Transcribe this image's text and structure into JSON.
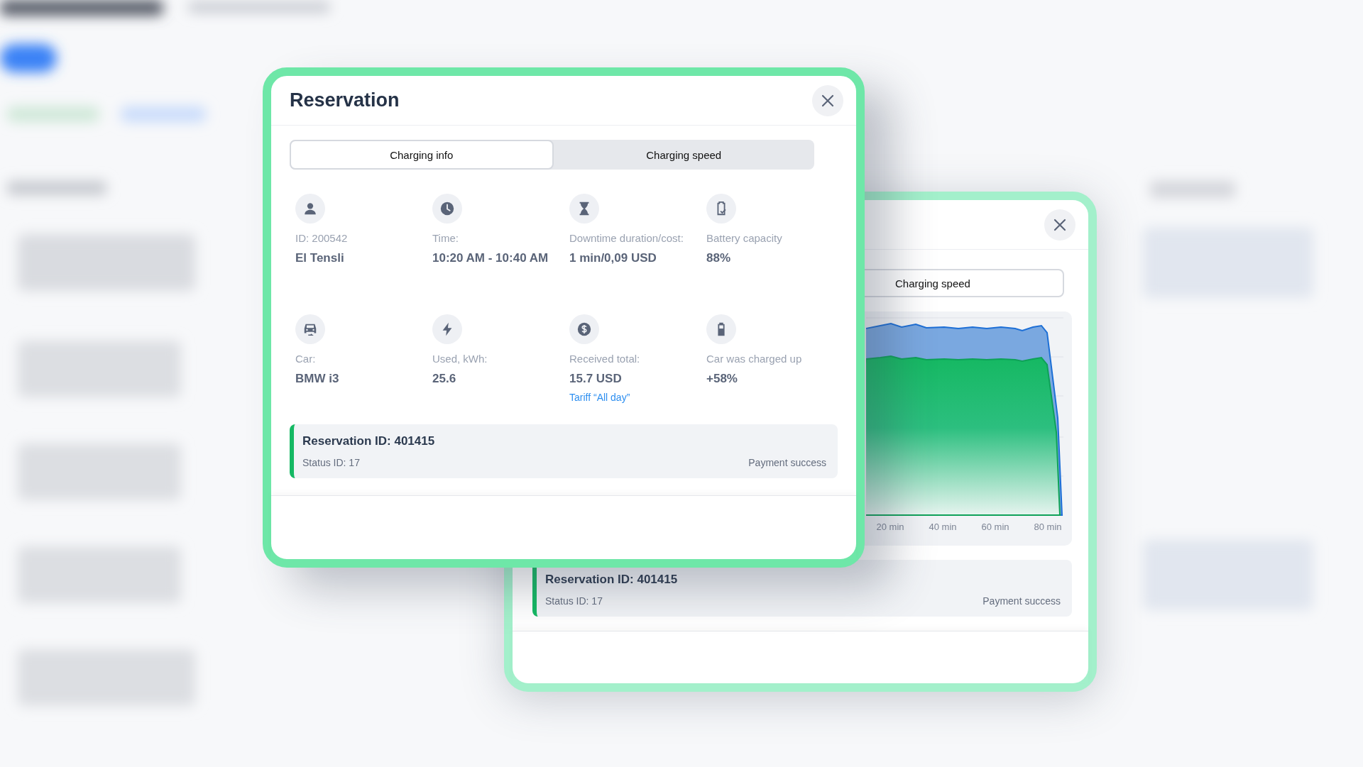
{
  "back_dialog": {
    "tabs": [
      {
        "label": "Charging speed",
        "selected": true
      }
    ],
    "chart": {
      "x_labels": [
        "20 min",
        "40 min",
        "60 min",
        "80 min"
      ]
    },
    "reservation": {
      "title": "Reservation ID: 401415",
      "status": "Status ID: 17",
      "payment": "Payment success"
    }
  },
  "dialog": {
    "title": "Reservation",
    "tabs": [
      {
        "label": "Charging info",
        "selected": true
      },
      {
        "label": "Charging speed",
        "selected": false
      }
    ],
    "fields": [
      {
        "kind": "person",
        "label": "ID: 200542",
        "value": "El Tensli"
      },
      {
        "kind": "clock",
        "label": "Time:",
        "value": "10:20 AM - 10:40 AM"
      },
      {
        "kind": "hourglass",
        "label": "Downtime duration/cost:",
        "value": "1 min/0,09 USD"
      },
      {
        "kind": "battery-check",
        "label": "Battery capacity",
        "value": "88%"
      },
      {
        "kind": "car",
        "label": "Car:",
        "value": "BMW i3"
      },
      {
        "kind": "bolt",
        "label": "Used, kWh:",
        "value": "25.6"
      },
      {
        "kind": "dollar",
        "label": "Received total:",
        "value": "15.7 USD",
        "link": "Tariff “All day”"
      },
      {
        "kind": "battery",
        "label": "Car was charged up",
        "value": "+58%"
      }
    ],
    "reservation": {
      "title": "Reservation ID: 401415",
      "status": "Status ID: 17",
      "payment": "Payment success"
    }
  }
}
